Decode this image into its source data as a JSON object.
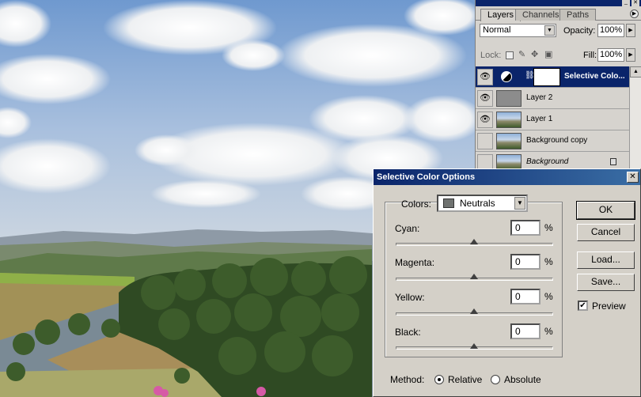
{
  "layers_panel": {
    "tabs": [
      "Layers",
      "Channels",
      "Paths"
    ],
    "blend_mode": "Normal",
    "opacity_label": "Opacity:",
    "opacity_value": "100%",
    "lock_label": "Lock:",
    "fill_label": "Fill:",
    "fill_value": "100%",
    "layers": [
      {
        "name": "Selective Colo...",
        "visible": true,
        "selected": true,
        "type": "adjustment"
      },
      {
        "name": "Layer 2",
        "visible": true,
        "selected": false,
        "type": "grey"
      },
      {
        "name": "Layer 1",
        "visible": true,
        "selected": false,
        "type": "photo"
      },
      {
        "name": "Background copy",
        "visible": false,
        "selected": false,
        "type": "photo"
      },
      {
        "name": "Background",
        "visible": false,
        "selected": false,
        "type": "photo",
        "locked": true
      }
    ]
  },
  "dialog": {
    "title": "Selective Color Options",
    "colors_label": "Colors:",
    "colors_value": "Neutrals",
    "colors_swatch": "#6f7270",
    "sliders": [
      {
        "label": "Cyan:",
        "value": "0",
        "unit": "%"
      },
      {
        "label": "Magenta:",
        "value": "0",
        "unit": "%"
      },
      {
        "label": "Yellow:",
        "value": "0",
        "unit": "%"
      },
      {
        "label": "Black:",
        "value": "0",
        "unit": "%"
      }
    ],
    "buttons": {
      "ok": "OK",
      "cancel": "Cancel",
      "load": "Load...",
      "save": "Save..."
    },
    "preview_label": "Preview",
    "preview_checked": true,
    "method_label": "Method:",
    "method_relative": "Relative",
    "method_absolute": "Absolute",
    "method_selected": "Relative"
  },
  "icons": {
    "eye": "eye-icon",
    "close": "close-icon",
    "dropdown": "chevron-down-icon",
    "lock": "lock-icon"
  },
  "colors": {
    "titlebar": "#0a246a",
    "selection": "#0a246a",
    "dialog_bg": "#d4d0c8"
  }
}
